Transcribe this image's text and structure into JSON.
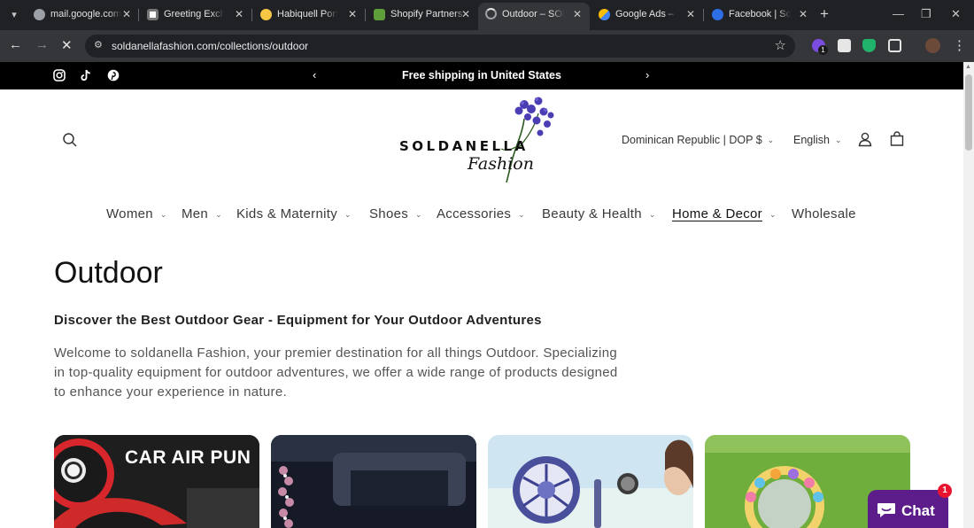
{
  "browser": {
    "tabs": [
      {
        "title": "mail.google.com",
        "favicon": "globe-icon",
        "active": false
      },
      {
        "title": "Greeting Exchan",
        "favicon": "greeting-exchange-icon",
        "active": false
      },
      {
        "title": "Habiquell Portfo",
        "favicon": "hand-wave-icon",
        "active": false
      },
      {
        "title": "Shopify Partners",
        "favicon": "shopify-icon",
        "active": false
      },
      {
        "title": "Outdoor – SOLD",
        "favicon": "loading-spinner-icon",
        "active": true
      },
      {
        "title": "Google Ads – Gr",
        "favicon": "google-ads-icon",
        "active": false
      },
      {
        "title": "Facebook | Soci",
        "favicon": "meta-icon",
        "active": false
      }
    ],
    "url": "soldanellafashion.com/collections/outdoor",
    "extension_badge": "1"
  },
  "announcement": {
    "text": "Free shipping in United States",
    "social": [
      "instagram-icon",
      "tiktok-icon",
      "pinterest-icon"
    ]
  },
  "header": {
    "logo_word": "SOLDANELLA",
    "logo_script": "Fashion",
    "country": "Dominican Republic | DOP $",
    "language": "English"
  },
  "nav": {
    "items": [
      {
        "label": "Women",
        "dropdown": true
      },
      {
        "label": "Men",
        "dropdown": true
      },
      {
        "label": "Kids & Maternity",
        "dropdown": true
      },
      {
        "label": "Shoes",
        "dropdown": true
      },
      {
        "label": "Accessories",
        "dropdown": true
      },
      {
        "label": "Beauty & Health",
        "dropdown": true
      },
      {
        "label": "Home & Decor",
        "dropdown": true,
        "current": true
      },
      {
        "label": "Wholesale",
        "dropdown": false
      }
    ]
  },
  "collection": {
    "title": "Outdoor",
    "subheading": "Discover the Best Outdoor Gear - Equipment for Your Outdoor Adventures",
    "description": "Welcome to soldanella Fashion, your premier destination for all things Outdoor. Specializing in top-quality equipment for outdoor adventures, we offer a wide range of products designed to enhance your experience in nature."
  },
  "products": [
    {
      "image_text": "CAR AIR PUN"
    },
    {
      "image_text": ""
    },
    {
      "image_text": ""
    },
    {
      "image_text": ""
    }
  ],
  "chat": {
    "label": "Chat",
    "badge": "1"
  },
  "colors": {
    "announcement_bg": "#000000",
    "chat_bg": "#5c1d8a",
    "badge": "#e8142f"
  }
}
